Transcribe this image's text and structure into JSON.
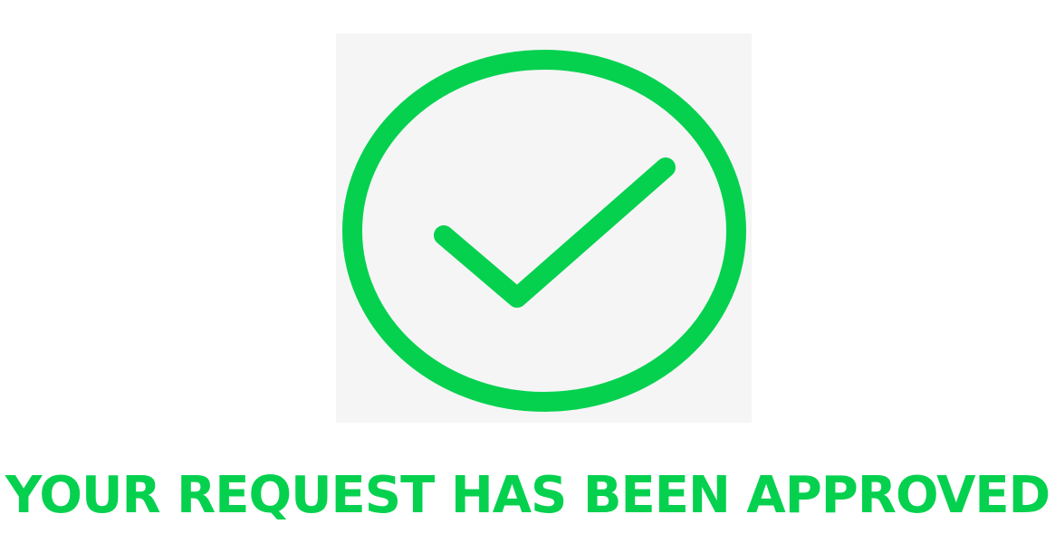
{
  "status": {
    "icon": "checkmark-circle-icon",
    "accent_color": "#05d14f",
    "icon_background": "#f5f5f5",
    "message": "YOUR REQUEST HAS BEEN APPROVED"
  }
}
